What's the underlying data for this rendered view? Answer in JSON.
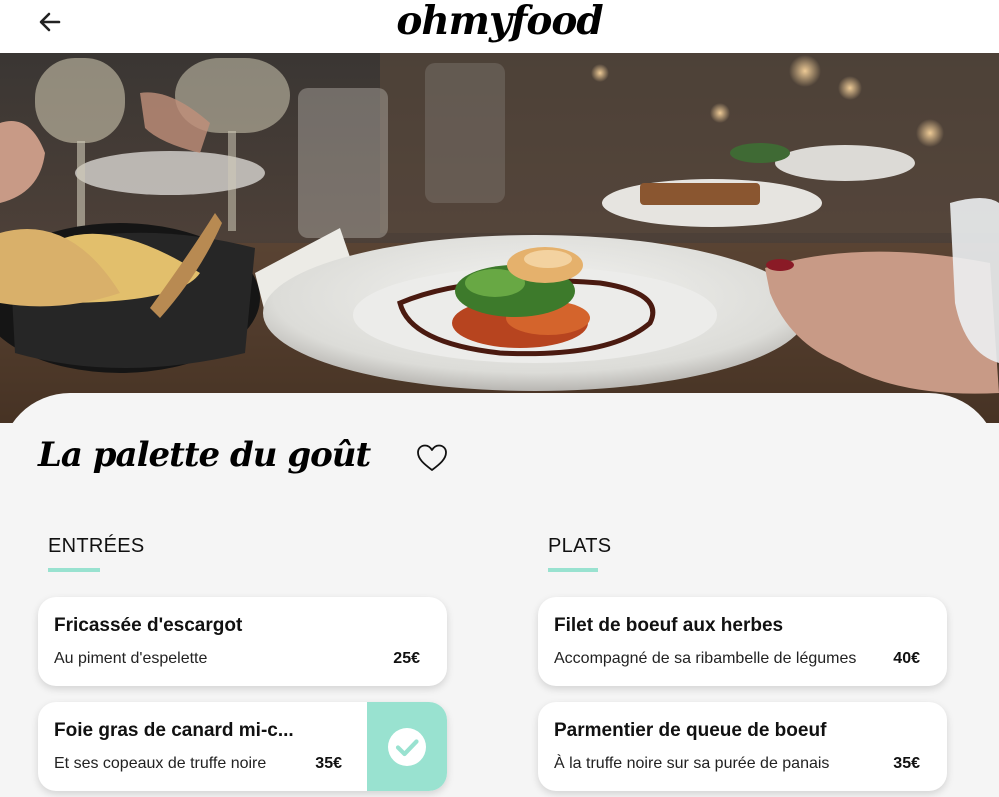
{
  "header": {
    "logo": "ohmyfood"
  },
  "restaurant": {
    "title": "La palette du goût"
  },
  "sections": [
    {
      "title": "ENTRÉES",
      "items": [
        {
          "name": "Fricassée d'escargot",
          "description": "Au piment d'espelette",
          "price": "25€",
          "checked": false
        },
        {
          "name": "Foie gras de canard mi-c...",
          "description": "Et ses copeaux de truffe noire",
          "price": "35€",
          "checked": true
        }
      ]
    },
    {
      "title": "PLATS",
      "items": [
        {
          "name": "Filet de boeuf aux herbes",
          "description": "Accompagné de sa ribambelle de légumes",
          "price": "40€",
          "checked": false
        },
        {
          "name": "Parmentier de queue de boeuf",
          "description": "À la truffe noire sur sa purée de panais",
          "price": "35€",
          "checked": false
        }
      ]
    }
  ],
  "icons": {
    "back": "arrow-left-icon",
    "favorite": "heart-outline-icon",
    "check": "check-circle-icon"
  },
  "colors": {
    "accent": "#99e2d0",
    "background": "#f5f5f5",
    "card": "#ffffff"
  }
}
